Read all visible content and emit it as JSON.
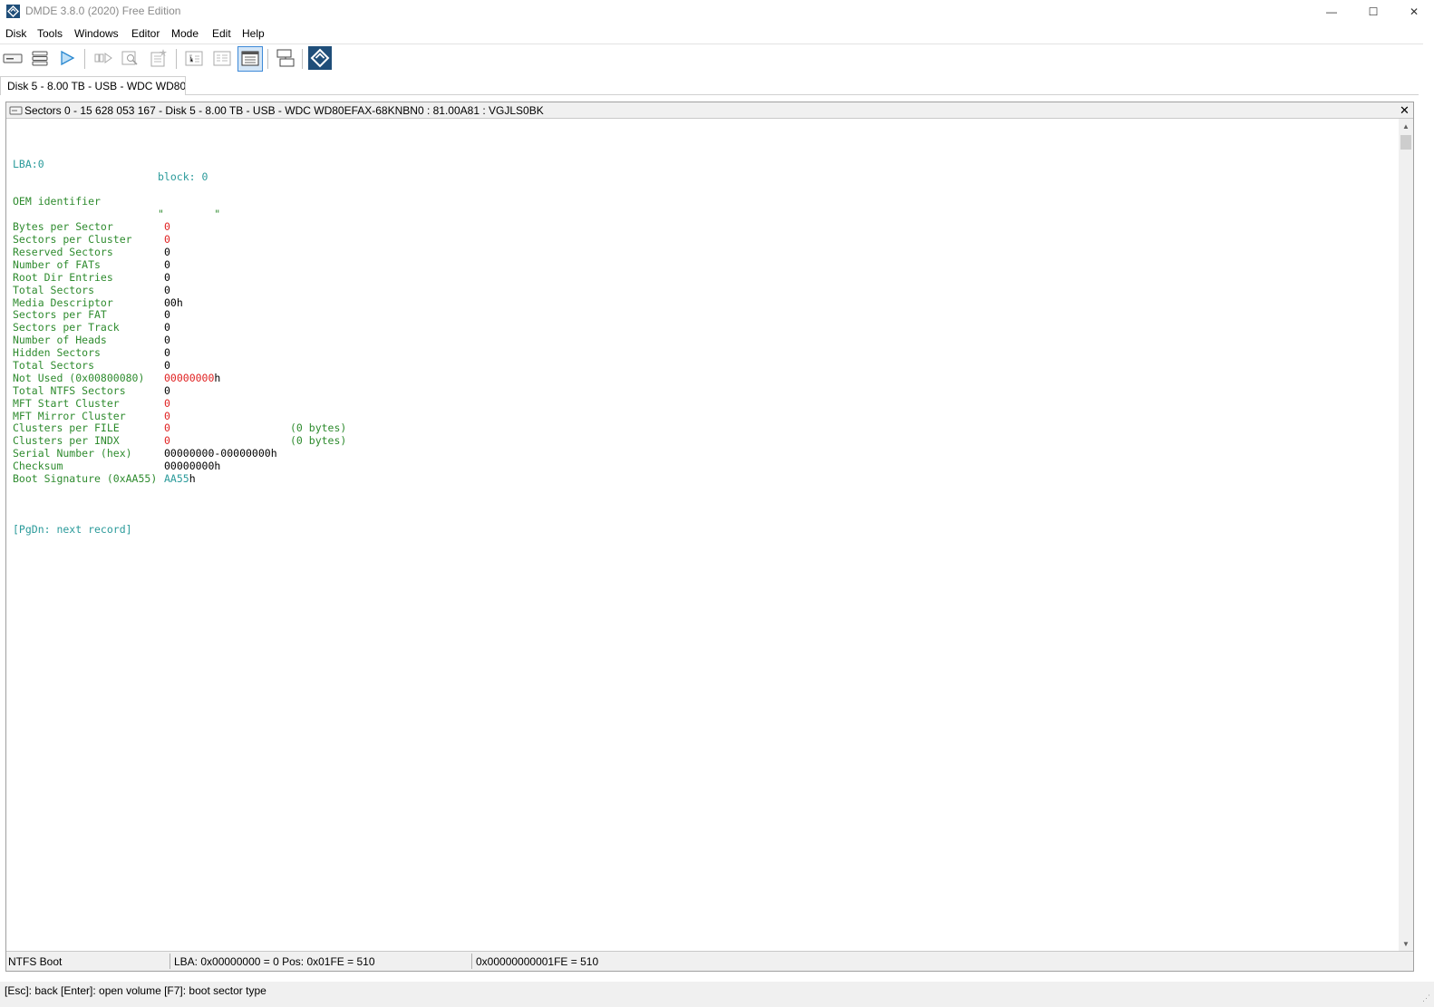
{
  "window": {
    "title": "DMDE 3.8.0 (2020) Free Edition",
    "minimize_glyph": "—",
    "maximize_glyph": "☐",
    "close_glyph": "✕"
  },
  "menu": [
    "Disk",
    "Tools",
    "Windows",
    "Editor",
    "Mode",
    "Edit",
    "Help"
  ],
  "toolbar": {
    "buttons": [
      "drive-icon",
      "partitions-icon",
      "play-icon",
      "next-sector-icon",
      "find-icon",
      "properties-icon",
      "tree-view-icon",
      "list-view-icon",
      "template-view-icon",
      "copy-sectors-icon",
      "dmde-logo-icon"
    ]
  },
  "tab": {
    "label": "Disk 5 - 8.00 TB - USB - WDC WD80..."
  },
  "panel": {
    "title": "Sectors 0 - 15 628 053 167 - Disk 5 - 8.00 TB - USB - WDC WD80EFAX-68KNBN0 : 81.00A81 : VGJLS0BK",
    "close_glyph": "✕"
  },
  "record": {
    "lba": "LBA:0",
    "block": "block: 0",
    "oem_label": "OEM identifier",
    "oem_value": "\"        \"",
    "fields": [
      {
        "label": "Bytes per Sector",
        "value": "0",
        "color": "red",
        "extra": ""
      },
      {
        "label": "Sectors per Cluster",
        "value": "0",
        "color": "red",
        "extra": ""
      },
      {
        "label": "Reserved Sectors",
        "value": "0",
        "color": "black",
        "extra": ""
      },
      {
        "label": "Number of FATs",
        "value": "0",
        "color": "black",
        "extra": ""
      },
      {
        "label": "Root Dir Entries",
        "value": "0",
        "color": "black",
        "extra": ""
      },
      {
        "label": "Total Sectors",
        "value": "0",
        "color": "black",
        "extra": ""
      },
      {
        "label": "Media Descriptor",
        "value": "00",
        "suffix": "h",
        "color": "black",
        "extra": ""
      },
      {
        "label": "Sectors per FAT",
        "value": "0",
        "color": "black",
        "extra": ""
      },
      {
        "label": "Sectors per Track",
        "value": "0",
        "color": "black",
        "extra": ""
      },
      {
        "label": "Number of Heads",
        "value": "0",
        "color": "black",
        "extra": ""
      },
      {
        "label": "Hidden Sectors",
        "value": "0",
        "color": "black",
        "extra": ""
      },
      {
        "label": "Total Sectors",
        "value": "0",
        "color": "black",
        "extra": ""
      },
      {
        "label": "Not Used (0x00800080)",
        "value": "00000000",
        "suffix": "h",
        "color": "red",
        "extra": ""
      },
      {
        "label": "Total NTFS Sectors",
        "value": "0",
        "color": "black",
        "extra": ""
      },
      {
        "label": "MFT Start Cluster",
        "value": "0",
        "color": "red",
        "extra": ""
      },
      {
        "label": "MFT Mirror Cluster",
        "value": "0",
        "color": "red",
        "extra": ""
      },
      {
        "label": "Clusters per FILE",
        "value": "0",
        "color": "red",
        "extra": "(0 bytes)"
      },
      {
        "label": "Clusters per INDX",
        "value": "0",
        "color": "red",
        "extra": "(0 bytes)"
      },
      {
        "label": "Serial Number (hex)",
        "value": "00000000-00000000",
        "suffix": "h",
        "color": "black",
        "extra": ""
      },
      {
        "label": "Checksum",
        "value": "00000000",
        "suffix": "h",
        "color": "black",
        "extra": ""
      },
      {
        "label": "Boot Signature (0xAA55)",
        "value": "AA55",
        "suffix": "h",
        "color": "teal",
        "extra": ""
      }
    ],
    "pgdn": "[PgDn: next record]"
  },
  "panel_status": {
    "type": "NTFS Boot",
    "position": "LBA: 0x00000000 = 0  Pos: 0x01FE = 510",
    "offset": "0x00000000001FE = 510"
  },
  "status_bar": {
    "hints": "[Esc]: back  [Enter]: open volume  [F7]: boot sector type"
  },
  "colors": {
    "label_green": "#2e8b2e",
    "value_teal": "#2a9a9a",
    "value_red": "#e02020",
    "accent_blue": "#1f4e79"
  }
}
